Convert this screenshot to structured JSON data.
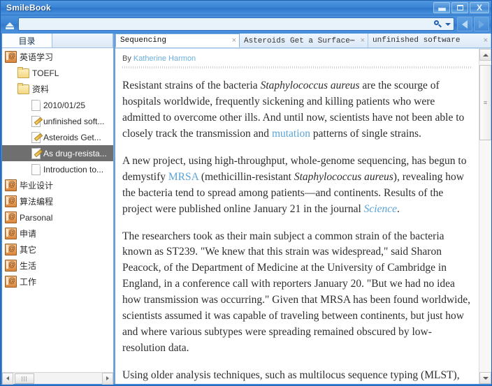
{
  "window": {
    "title": "SmileBook",
    "buttons": {
      "minimize": "minimize-button",
      "maximize": "maximize-button",
      "close": "X"
    }
  },
  "toolbar": {
    "eject_icon": "eject-icon",
    "search_value": "",
    "search_placeholder": "",
    "search_icon": "search-icon",
    "dropdown_icon": "chevron-down-icon",
    "back_label": "back-arrow-icon",
    "forward_label": "forward-arrow-icon"
  },
  "sidebar": {
    "tab_label": "目录",
    "tree": [
      {
        "label": "英语学习",
        "icon": "notebook-icon",
        "level": 0,
        "selected": false
      },
      {
        "label": "TOEFL",
        "icon": "folder-icon",
        "level": 1,
        "selected": false
      },
      {
        "label": "资料",
        "icon": "folder-icon",
        "level": 1,
        "selected": false
      },
      {
        "label": "2010/01/25",
        "icon": "page-icon",
        "level": 2,
        "selected": false
      },
      {
        "label": "unfinished soft...",
        "icon": "page-edit-icon",
        "level": 2,
        "selected": false
      },
      {
        "label": "Asteroids Get...",
        "icon": "page-edit-icon",
        "level": 2,
        "selected": false
      },
      {
        "label": "As drug-resista...",
        "icon": "page-edit-icon",
        "level": 2,
        "selected": true
      },
      {
        "label": "Introduction to...",
        "icon": "page-icon",
        "level": 2,
        "selected": false
      },
      {
        "label": "毕业设计",
        "icon": "notebook-icon",
        "level": 0,
        "selected": false
      },
      {
        "label": "算法编程",
        "icon": "notebook-icon",
        "level": 0,
        "selected": false
      },
      {
        "label": "Parsonal",
        "icon": "notebook-icon",
        "level": 0,
        "selected": false
      },
      {
        "label": "申请",
        "icon": "notebook-icon",
        "level": 0,
        "selected": false
      },
      {
        "label": "其它",
        "icon": "notebook-icon",
        "level": 0,
        "selected": false
      },
      {
        "label": "生活",
        "icon": "notebook-icon",
        "level": 0,
        "selected": false
      },
      {
        "label": "工作",
        "icon": "notebook-icon",
        "level": 0,
        "selected": false
      }
    ],
    "hscroll": {
      "left_icon": "scroll-left-icon",
      "right_icon": "scroll-right-icon",
      "thumb": "|||"
    }
  },
  "tabs": [
    {
      "label": "Sequencing",
      "close": "×",
      "active": true
    },
    {
      "label": "Asteroids Get a Surface⋯",
      "close": "×",
      "active": false
    },
    {
      "label": "unfinished software",
      "close": "×",
      "active": false
    }
  ],
  "article": {
    "by_prefix": "By",
    "author": "Katherine Harmon",
    "paragraphs": [
      {
        "runs": [
          {
            "t": "Resistant strains of the bacteria "
          },
          {
            "t": "Staphylococcus aureus",
            "s": "i"
          },
          {
            "t": " are the scourge of hospitals worldwide, frequently sickening and killing patients who were admitted to overcome other ills. And until now, scientists have not been able to closely track the transmission and "
          },
          {
            "t": "mutation",
            "s": "a"
          },
          {
            "t": " patterns of single strains."
          }
        ]
      },
      {
        "runs": [
          {
            "t": "A new project, using high-throughput, whole-genome sequencing, has begun to demystify "
          },
          {
            "t": "MRSA",
            "s": "a"
          },
          {
            "t": " (methicillin-resistant "
          },
          {
            "t": "Staphylococcus aureus",
            "s": "i"
          },
          {
            "t": "), revealing how the bacteria tend to spread among patients—and continents. Results of the project were published online January 21 in the journal "
          },
          {
            "t": "Science",
            "s": "ai"
          },
          {
            "t": "."
          }
        ]
      },
      {
        "runs": [
          {
            "t": "The researchers took as their main subject a common strain of the bacteria known as ST239. \"We knew that this strain was widespread,\" said Sharon Peacock, of the Department of Medicine at the University of Cambridge in England, in a conference call with reporters January 20. \"But we had no idea how transmission was occurring.\" Given that MRSA has been found worldwide, scientists assumed it was capable of traveling between continents, but just how and where various subtypes were spreading remained obscured by low-resolution data."
          }
        ]
      },
      {
        "runs": [
          {
            "t": "Using older analysis techniques, such as multilocus sequence typing (MLST),"
          }
        ]
      }
    ],
    "scrollbar": {
      "up_icon": "scroll-up-icon",
      "down_icon": "scroll-down-icon"
    }
  },
  "colors": {
    "titlebar": "#3b84d4",
    "selection": "#6f6f6f",
    "link": "#5aa3d6",
    "accent_border": "#1f5fb0"
  }
}
